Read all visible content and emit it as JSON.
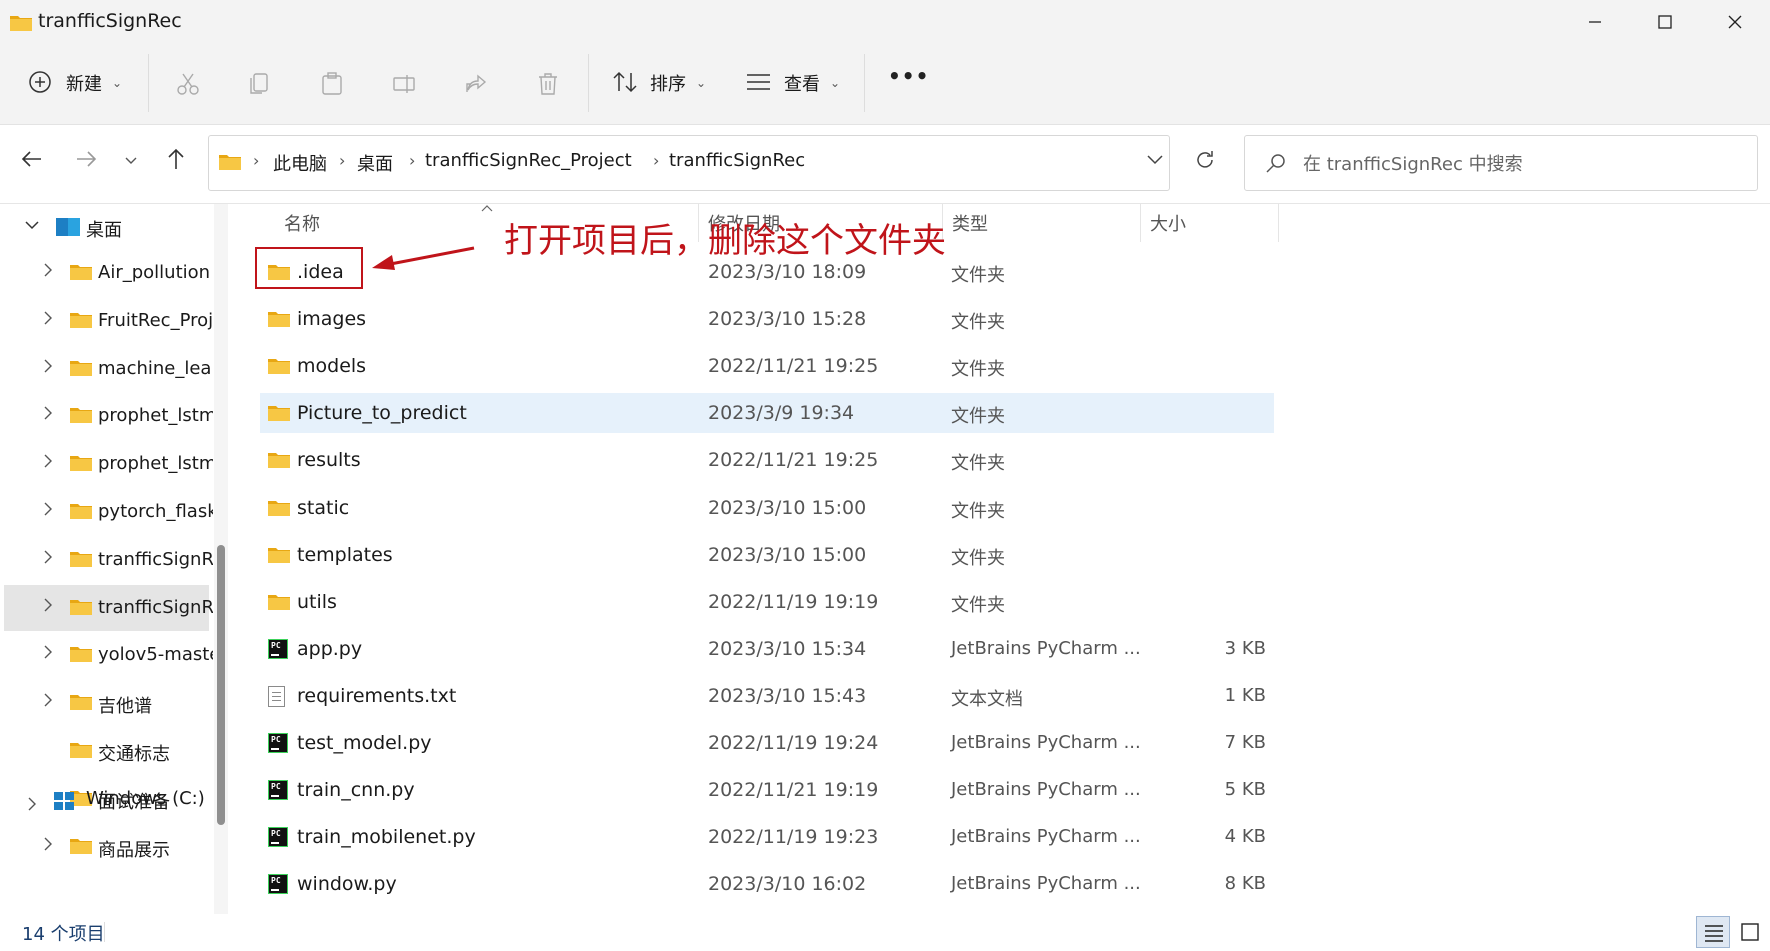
{
  "window": {
    "title": "tranfficSignRec",
    "minimize_icon": "minimize-icon",
    "maximize_icon": "maximize-icon",
    "close_icon": "close-icon"
  },
  "toolbar": {
    "new_label": "新建",
    "sort_label": "排序",
    "view_label": "查看",
    "more_label": "•••",
    "icons": [
      "cut-icon",
      "copy-icon",
      "paste-icon",
      "rename-icon",
      "share-icon",
      "delete-icon"
    ]
  },
  "address": {
    "crumbs": [
      "此电脑",
      "桌面",
      "tranfficSignRec_Project",
      "tranfficSignRec"
    ],
    "search_placeholder": "在 tranfficSignRec 中搜索"
  },
  "sidebar": {
    "root": "桌面",
    "items": [
      {
        "label": "Air_pollution",
        "expandable": true
      },
      {
        "label": "FruitRec_Proj",
        "expandable": true
      },
      {
        "label": "machine_lear",
        "expandable": true
      },
      {
        "label": "prophet_lstm",
        "expandable": true
      },
      {
        "label": "prophet_lstm",
        "expandable": true
      },
      {
        "label": "pytorch_flask",
        "expandable": true
      },
      {
        "label": "tranfficSignR",
        "expandable": true
      },
      {
        "label": "tranfficSignR",
        "expandable": true,
        "selected": true
      },
      {
        "label": "yolov5-maste",
        "expandable": true
      },
      {
        "label": "吉他谱",
        "expandable": true
      },
      {
        "label": "交通标志",
        "expandable": false
      },
      {
        "label": "面试准备",
        "expandable": false
      },
      {
        "label": "商品展示",
        "expandable": true
      }
    ],
    "drive": "Windows (C:)"
  },
  "columns": {
    "name": "名称",
    "date": "修改日期",
    "type": "类型",
    "size": "大小"
  },
  "files": [
    {
      "name": ".idea",
      "date": "2023/3/10 18:09",
      "type": "文件夹",
      "size": "",
      "icon": "folder"
    },
    {
      "name": "images",
      "date": "2023/3/10 15:28",
      "type": "文件夹",
      "size": "",
      "icon": "folder"
    },
    {
      "name": "models",
      "date": "2022/11/21 19:25",
      "type": "文件夹",
      "size": "",
      "icon": "folder"
    },
    {
      "name": "Picture_to_predict",
      "date": "2023/3/9 19:34",
      "type": "文件夹",
      "size": "",
      "icon": "folder",
      "highlighted": true
    },
    {
      "name": "results",
      "date": "2022/11/21 19:25",
      "type": "文件夹",
      "size": "",
      "icon": "folder"
    },
    {
      "name": "static",
      "date": "2023/3/10 15:00",
      "type": "文件夹",
      "size": "",
      "icon": "folder"
    },
    {
      "name": "templates",
      "date": "2023/3/10 15:00",
      "type": "文件夹",
      "size": "",
      "icon": "folder"
    },
    {
      "name": "utils",
      "date": "2022/11/19 19:19",
      "type": "文件夹",
      "size": "",
      "icon": "folder"
    },
    {
      "name": "app.py",
      "date": "2023/3/10 15:34",
      "type": "JetBrains PyCharm ...",
      "size": "3 KB",
      "icon": "pycharm"
    },
    {
      "name": "requirements.txt",
      "date": "2023/3/10 15:43",
      "type": "文本文档",
      "size": "1 KB",
      "icon": "text"
    },
    {
      "name": "test_model.py",
      "date": "2022/11/19 19:24",
      "type": "JetBrains PyCharm ...",
      "size": "7 KB",
      "icon": "pycharm"
    },
    {
      "name": "train_cnn.py",
      "date": "2022/11/21 19:19",
      "type": "JetBrains PyCharm ...",
      "size": "5 KB",
      "icon": "pycharm"
    },
    {
      "name": "train_mobilenet.py",
      "date": "2022/11/19 19:23",
      "type": "JetBrains PyCharm ...",
      "size": "4 KB",
      "icon": "pycharm"
    },
    {
      "name": "window.py",
      "date": "2023/3/10 16:02",
      "type": "JetBrains PyCharm ...",
      "size": "8 KB",
      "icon": "pycharm"
    }
  ],
  "annotation": {
    "text": "打开项目后，删除这个文件夹",
    "color": "#c0141a"
  },
  "status": {
    "item_count": "14 个项目"
  },
  "colors": {
    "folder": "#f7c744",
    "selection": "#e6f1fb",
    "accent": "#1a3e6e"
  }
}
